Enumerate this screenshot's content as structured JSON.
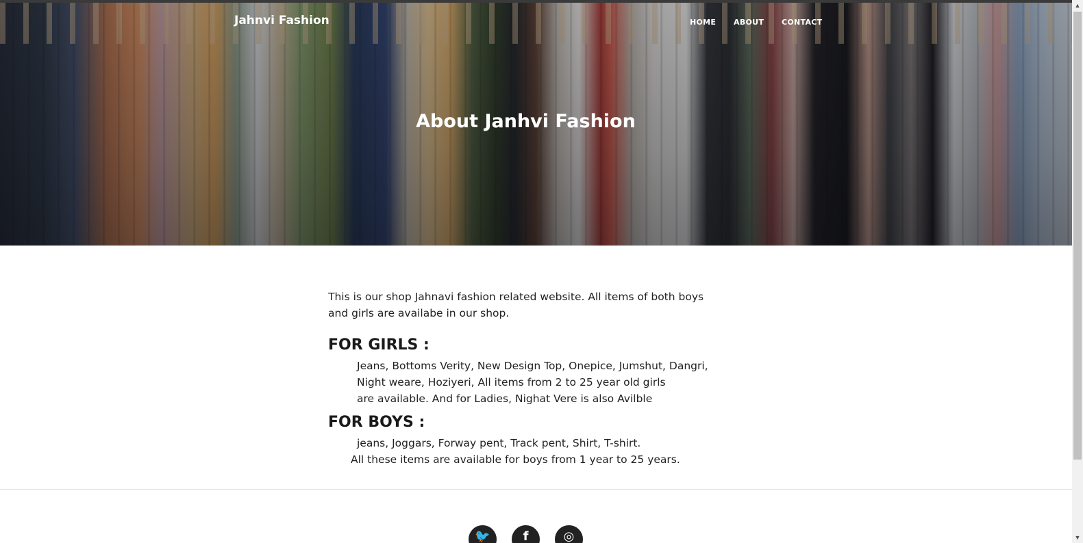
{
  "header": {
    "brand": "Jahnvi Fashion",
    "nav": {
      "home": "HOME",
      "about": "ABOUT",
      "contact": "CONTACT"
    }
  },
  "hero": {
    "title": "About Janhvi Fashion"
  },
  "content": {
    "intro": "This is our shop Jahnavi fashion related website. All items of both boys and girls are availabe in our shop.",
    "girls": {
      "heading": "FOR GIRLS :",
      "lines": [
        "Jeans, Bottoms Verity, New Design Top, Onepice, Jumshut, Dangri,",
        "Night weare, Hoziyeri, All items from 2 to 25 year old girls",
        "are available. And for Ladies, Nighat Vere is also Avilble"
      ]
    },
    "boys": {
      "heading": "FOR BOYS :",
      "lines": [
        "jeans, Joggars, Forway pent, Track pent, Shirt, T-shirt.",
        "All these items are available for boys from 1 year to 25 years."
      ]
    }
  },
  "footer": {
    "socials": [
      {
        "icon": "twitter-icon",
        "glyph": "🐦"
      },
      {
        "icon": "facebook-icon",
        "glyph": "f"
      },
      {
        "icon": "instagram-icon",
        "glyph": "◎"
      }
    ]
  },
  "scrollbar": {
    "up": "▲",
    "down": "▼"
  }
}
